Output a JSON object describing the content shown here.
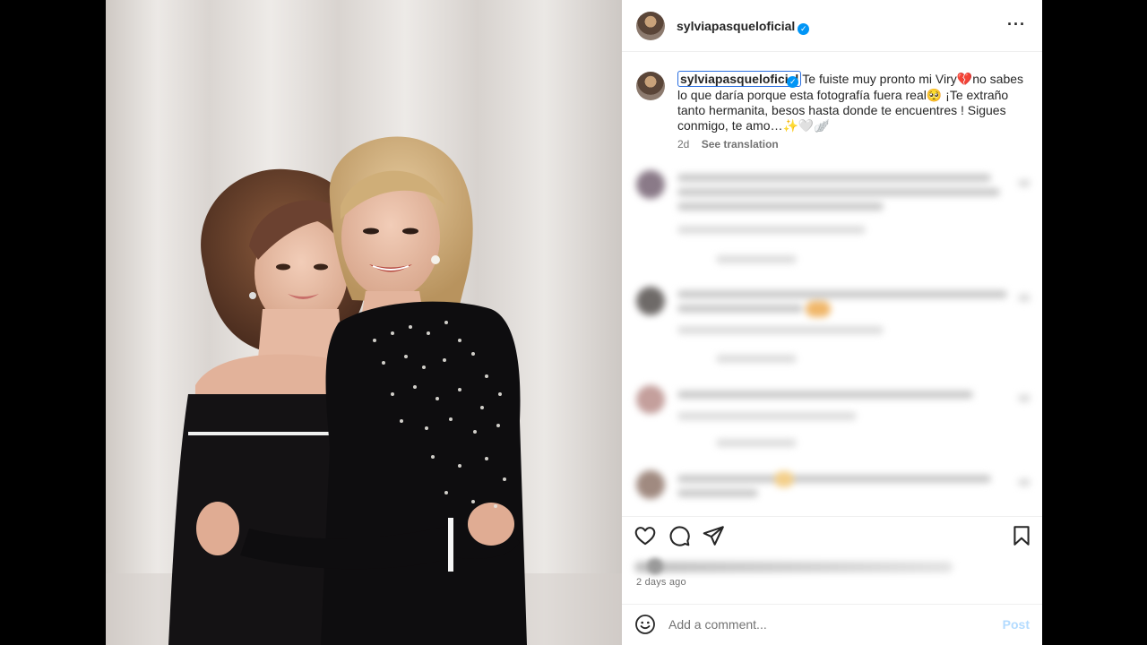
{
  "post": {
    "author": "sylviapasqueloficial",
    "verified_icon": "verified-badge-icon",
    "more_icon": "more-options-icon",
    "caption_user": "sylviapasqueloficial",
    "caption_text": "Te fuiste muy pronto mi Viry💔no sabes lo que daría porque esta fotografía fuera real🥺 ¡Te extraño tanto hermanita, besos hasta donde te encuentres ! Sigues conmigo, te amo…✨🤍🪽",
    "caption_age": "2d",
    "see_translation": "See translation",
    "posted_ago": "2 days ago"
  },
  "actions": {
    "like_icon": "heart-icon",
    "comment_icon": "comment-icon",
    "share_icon": "send-icon",
    "save_icon": "bookmark-icon"
  },
  "comment_box": {
    "placeholder": "Add a comment...",
    "post_label": "Post",
    "emoji_icon": "emoji-icon"
  },
  "colors": {
    "link_blue": "#0095f6",
    "post_disabled": "#b3dbff",
    "text": "#262626",
    "muted": "#737373"
  }
}
